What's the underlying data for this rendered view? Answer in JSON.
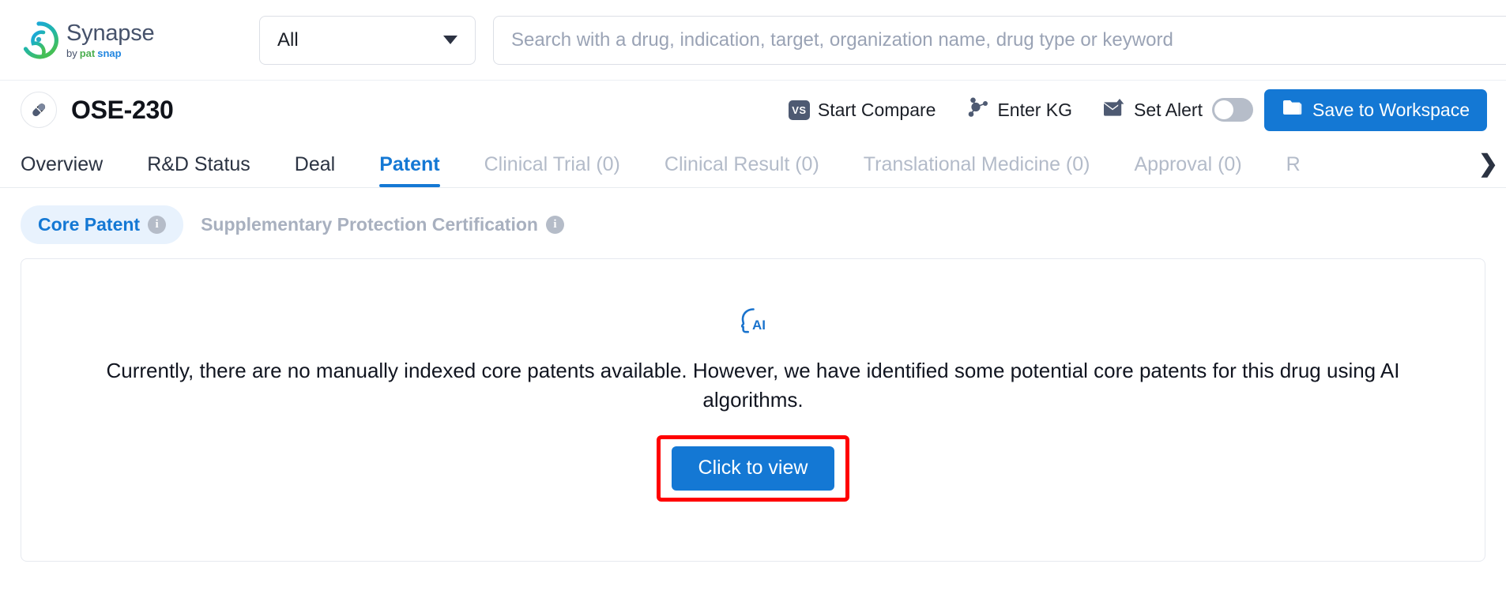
{
  "brand": {
    "name": "Synapse",
    "by": "by",
    "pat": "pat",
    "snap": "snap",
    "logo_icon": "synapse-swirl-logo"
  },
  "search": {
    "scope_value": "All",
    "scope_caret_icon": "chevron-down-icon",
    "placeholder": "Search with a drug, indication, target, organization name, drug type or keyword",
    "value": ""
  },
  "drug": {
    "avatar_icon": "capsule-icon",
    "name": "OSE-230"
  },
  "actions": {
    "compare": {
      "label": "Start Compare",
      "icon": "vs-icon",
      "icon_text": "VS"
    },
    "kg": {
      "label": "Enter KG",
      "icon": "knowledge-graph-icon"
    },
    "alert": {
      "label": "Set Alert",
      "icon": "envelope-alert-icon",
      "toggle_state": "off"
    },
    "save": {
      "label": "Save to Workspace",
      "icon": "folder-icon"
    }
  },
  "tabs": [
    {
      "label": "Overview",
      "state": "normal"
    },
    {
      "label": "R&D Status",
      "state": "normal"
    },
    {
      "label": "Deal",
      "state": "normal"
    },
    {
      "label": "Patent",
      "state": "active"
    },
    {
      "label": "Clinical Trial (0)",
      "state": "disabled"
    },
    {
      "label": "Clinical Result (0)",
      "state": "disabled"
    },
    {
      "label": "Translational Medicine (0)",
      "state": "disabled"
    },
    {
      "label": "Approval (0)",
      "state": "disabled"
    },
    {
      "label": "R",
      "state": "disabled"
    }
  ],
  "tabs_scroll_next_icon": "chevron-right-icon",
  "subtabs": [
    {
      "label": "Core Patent",
      "state": "active",
      "info_icon": "info-icon",
      "info_glyph": "i"
    },
    {
      "label": "Supplementary Protection Certification",
      "state": "disabled",
      "info_icon": "info-icon",
      "info_glyph": "i"
    }
  ],
  "content": {
    "ai_icon": "ai-head-icon",
    "empty_message": "Currently, there are no manually indexed core patents available. However, we have identified some potential core patents for this drug using AI algorithms.",
    "cta_label": "Click to view"
  },
  "colors": {
    "accent_blue": "#1478d4",
    "highlight_red": "#ff0000",
    "muted_grey": "#b3bbc9",
    "subtab_active_bg": "#e8f2fd",
    "toggle_off": "#b6bdc9"
  }
}
